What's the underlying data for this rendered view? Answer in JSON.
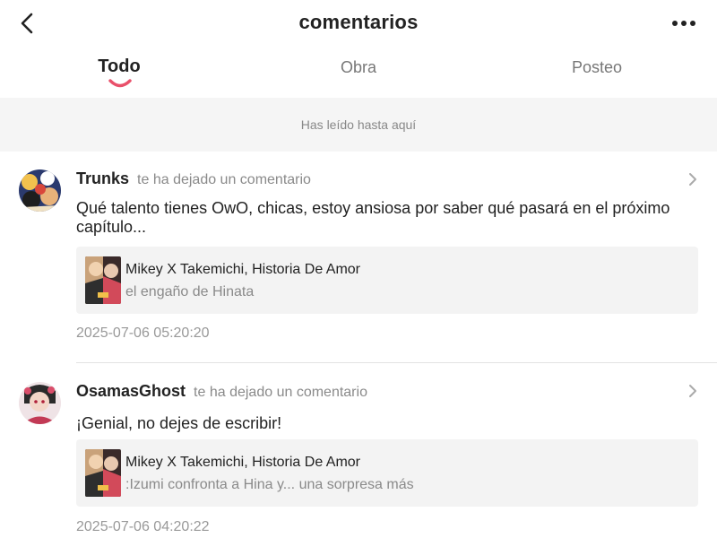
{
  "header": {
    "title": "comentarios",
    "back_icon": "chevron-left-icon",
    "more_icon": "more-horizontal-icon"
  },
  "tabs": [
    {
      "label": "Todo",
      "active": true
    },
    {
      "label": "Obra",
      "active": false
    },
    {
      "label": "Posteo",
      "active": false
    }
  ],
  "banner": {
    "text": "Has leído hasta aquí"
  },
  "comments": [
    {
      "username": "Trunks",
      "action": "te ha dejado un comentario",
      "text": "Qué talento tienes OwO, chicas, estoy ansiosa por saber qué pasará en el próximo capítulo...",
      "work_title": "Mikey X Takemichi, Historia De Amor",
      "chapter": "el engaño de Hinata",
      "timestamp": "2025-07-06 05:20:20"
    },
    {
      "username": "OsamasGhost",
      "action": "te ha dejado un comentario",
      "text": "¡Genial, no dejes de escribir!",
      "work_title": "Mikey X Takemichi, Historia De Amor",
      "chapter": ":Izumi confronta a Hina y... una sorpresa más",
      "timestamp": "2025-07-06 04:20:22"
    }
  ],
  "colors": {
    "accent": "#e9506a",
    "banner_bg": "#f5f5f5",
    "card_bg": "#f3f3f3"
  }
}
